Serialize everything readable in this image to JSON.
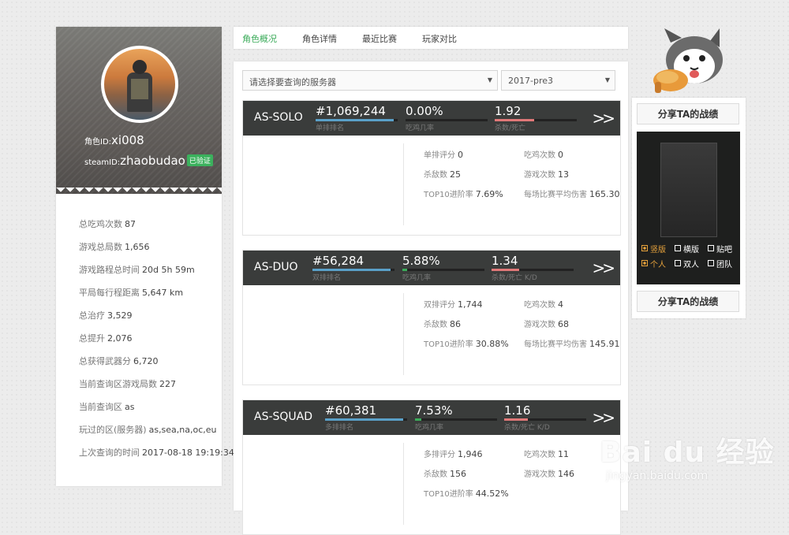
{
  "profile": {
    "role_id_label": "角色ID:",
    "role_id": "xi008",
    "steam_id_label": "steamID:",
    "steam_id": "zhaobudao",
    "steam_badge": "已验证",
    "stats": [
      {
        "label": "总吃鸡次数",
        "value": "87"
      },
      {
        "label": "游戏总局数",
        "value": "1,656"
      },
      {
        "label": "游戏路程总时间",
        "value": "20d 5h 59m"
      },
      {
        "label": "平局每行程距离",
        "value": "5,647 km"
      },
      {
        "label": "总治疗",
        "value": "3,529"
      },
      {
        "label": "总提升",
        "value": "2,076"
      },
      {
        "label": "总获得武器分",
        "value": "6,720"
      },
      {
        "label": "当前查询区游戏局数",
        "value": "227"
      },
      {
        "label": "当前查询区",
        "value": "as"
      },
      {
        "label": "玩过的区(服务器)",
        "value": "as,sea,na,oc,eu"
      },
      {
        "label": "上次查询的时间",
        "value": "2017-08-18 19:19:34"
      }
    ]
  },
  "tabs": [
    "角色概况",
    "角色详情",
    "最近比赛",
    "玩家对比"
  ],
  "server_select": {
    "placeholder": "请选择要查询的服务器",
    "season": "2017-pre3"
  },
  "modes": [
    {
      "name": "AS-SOLO",
      "rank": "#1,069,244",
      "rank_label": "单排排名",
      "rank_fill": 0.95,
      "win_rate": "0.00%",
      "win_label": "吃鸡几率",
      "win_fill": 0.0,
      "kd": "1.92",
      "kd_label": "杀数/死亡",
      "kd_fill": 0.48,
      "details": [
        {
          "label": "单排评分",
          "value": "0"
        },
        {
          "label": "吃鸡次数",
          "value": "0"
        },
        {
          "label": "杀敌数",
          "value": "25"
        },
        {
          "label": "游戏次数",
          "value": "13"
        },
        {
          "label": "TOP10进阶率",
          "value": "7.69%"
        },
        {
          "label": "每场比赛平均伤害",
          "value": "165.30"
        }
      ]
    },
    {
      "name": "AS-DUO",
      "rank": "#56,284",
      "rank_label": "双排排名",
      "rank_fill": 0.95,
      "win_rate": "5.88%",
      "win_label": "吃鸡几率",
      "win_fill": 0.06,
      "kd": "1.34",
      "kd_label": "杀数/死亡 K/D",
      "kd_fill": 0.34,
      "details": [
        {
          "label": "双排评分",
          "value": "1,744"
        },
        {
          "label": "吃鸡次数",
          "value": "4"
        },
        {
          "label": "杀敌数",
          "value": "86"
        },
        {
          "label": "游戏次数",
          "value": "68"
        },
        {
          "label": "TOP10进阶率",
          "value": "30.88%"
        },
        {
          "label": "每场比赛平均伤害",
          "value": "145.91"
        }
      ]
    },
    {
      "name": "AS-SQUAD",
      "rank": "#60,381",
      "rank_label": "多排排名",
      "rank_fill": 0.95,
      "win_rate": "7.53%",
      "win_label": "吃鸡几率",
      "win_fill": 0.08,
      "kd": "1.16",
      "kd_label": "杀数/死亡 K/D",
      "kd_fill": 0.29,
      "details": [
        {
          "label": "多排评分",
          "value": "1,946"
        },
        {
          "label": "吃鸡次数",
          "value": "11"
        },
        {
          "label": "杀敌数",
          "value": "156"
        },
        {
          "label": "游戏次数",
          "value": "146"
        },
        {
          "label": "TOP10进阶率",
          "value": "44.52%"
        }
      ]
    }
  ],
  "share": {
    "button_label": "分享TA的战绩",
    "options_row1": [
      {
        "label": "竖版",
        "on": true
      },
      {
        "label": "横版",
        "on": false
      },
      {
        "label": "贴吧",
        "on": false
      }
    ],
    "options_row2": [
      {
        "label": "个人",
        "on": true
      },
      {
        "label": "双人",
        "on": false
      },
      {
        "label": "团队",
        "on": false
      }
    ]
  },
  "watermark": {
    "brand": "Bai du 经验",
    "url": "jingyan.baidu.com"
  },
  "colors": {
    "accent_green": "#3bab5a",
    "rank_bar": "#5aa0c8",
    "win_bar": "#3bab5a",
    "kd_bar": "#e07878",
    "header_dark": "#3a3c3b",
    "share_option_active": "#e6a23c"
  }
}
